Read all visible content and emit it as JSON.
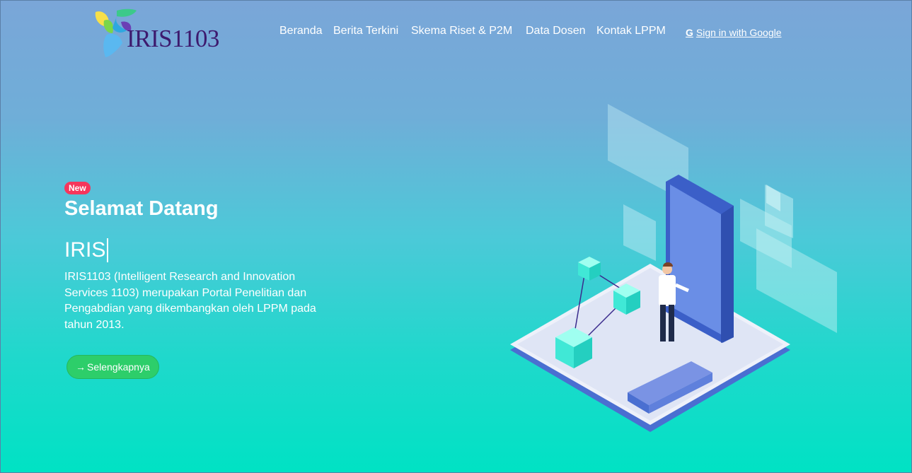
{
  "brand": {
    "name": "IRIS1103"
  },
  "nav": [
    {
      "label": "Beranda"
    },
    {
      "label": "Berita Terkini"
    },
    {
      "label": "Skema Riset & P2M"
    },
    {
      "label": "Data Dosen"
    },
    {
      "label": "Kontak LPPM"
    }
  ],
  "auth": {
    "google_label": "Sign in with Google",
    "icon": "google-g-icon"
  },
  "hero": {
    "badge": "New",
    "title": "Selamat Datang",
    "typed": "IRIS",
    "description": "IRIS1103 (Intelligent Research and Innovation Services 1103) merupakan Portal Penelitian dan Pengabdian yang dikembangkan oleh LPPM pada tahun 2013.",
    "cta_label": "Selengkapnya",
    "cta_icon": "arrow-right-icon"
  },
  "colors": {
    "bg_top": "#7aa6d8",
    "bg_bottom": "#00e2c4",
    "badge": "#f5365c",
    "cta": "#2dce6a",
    "brand_text": "#3d1a6e"
  }
}
